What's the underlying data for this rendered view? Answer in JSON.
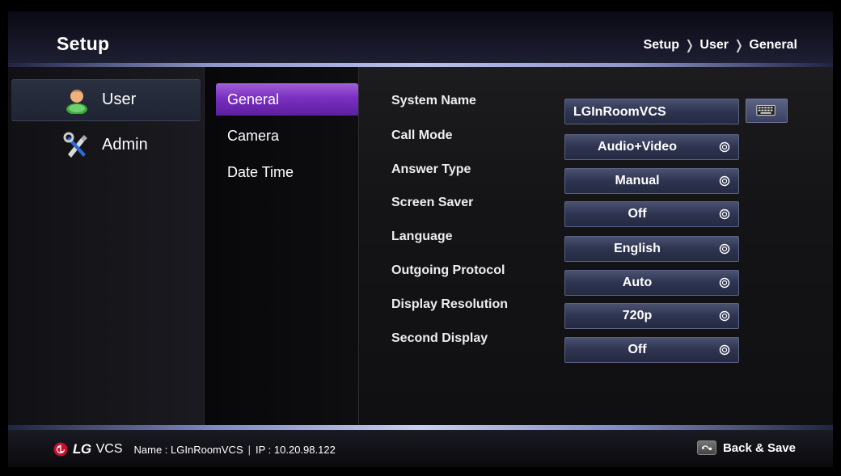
{
  "header": {
    "title": "Setup",
    "breadcrumb": [
      "Setup",
      "User",
      "General"
    ],
    "breadcrumb_separator": "❭"
  },
  "sidebar": {
    "items": [
      {
        "label": "User",
        "icon": "user-icon",
        "selected": true
      },
      {
        "label": "Admin",
        "icon": "tools-icon",
        "selected": false
      }
    ]
  },
  "submenu": {
    "items": [
      {
        "label": "General",
        "selected": true
      },
      {
        "label": "Camera",
        "selected": false
      },
      {
        "label": "Date Time",
        "selected": false
      }
    ]
  },
  "settings": {
    "system_name": {
      "label": "System Name",
      "value": "LGInRoomVCS",
      "icon": "keyboard-icon"
    },
    "rows": [
      {
        "label": "Call Mode",
        "value": "Audio+Video"
      },
      {
        "label": "Answer Type",
        "value": "Manual"
      },
      {
        "label": "Screen Saver",
        "value": "Off"
      },
      {
        "label": "Language",
        "value": "English"
      },
      {
        "label": "Outgoing Protocol",
        "value": "Auto"
      },
      {
        "label": "Display Resolution",
        "value": "720p"
      },
      {
        "label": "Second Display",
        "value": "Off"
      }
    ]
  },
  "footer": {
    "brand": "LG",
    "product": "VCS",
    "name_text": "Name : LGInRoomVCS",
    "divider": "|",
    "ip_text": "IP : 10.20.98.122",
    "back_save": "Back & Save"
  },
  "colors": {
    "accent_purple": "#7a2fc0",
    "header_line": "#b8c0ea",
    "select_bg": "#2e3450",
    "lg_red": "#c8102e"
  }
}
